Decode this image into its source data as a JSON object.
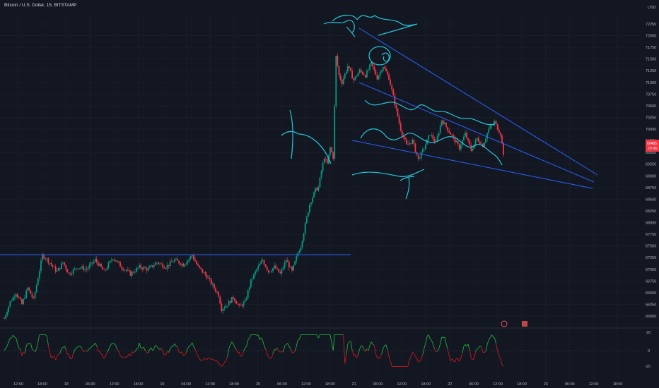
{
  "header": {
    "title": "Bitcoin / U.S. Dollar, 15, BITSTAMP",
    "currency": "USD"
  },
  "price_label": {
    "value": "69485",
    "sub": "07:45",
    "color": "#f23645"
  },
  "indicator_axis": {
    "upper": "20",
    "zero": "0",
    "lower": "-20"
  },
  "colors": {
    "up": "#089981",
    "down": "#f23645",
    "drawing_blue": "#2962ff",
    "drawing_cyan": "#26c6da",
    "osc_up": "#22ab3d",
    "osc_down": "#c5191f"
  },
  "chart_data": {
    "type": "candlestick",
    "title": "Bitcoin / U.S. Dollar, 15, BITSTAMP",
    "y_ticks": [
      "72250",
      "72000",
      "71750",
      "71500",
      "71250",
      "71000",
      "70750",
      "70500",
      "70250",
      "70000",
      "69750",
      "69500",
      "69250",
      "69000",
      "68750",
      "68500",
      "68250",
      "68000",
      "67750",
      "67500",
      "67250",
      "67000",
      "66750",
      "66500",
      "66250",
      "66000"
    ],
    "x_ticks": [
      "12:00",
      "18:00",
      "18",
      "06:00",
      "12:00",
      "18:00",
      "19",
      "06:00",
      "12:00",
      "18:00",
      "20",
      "06:00",
      "12:00",
      "18:00",
      "21",
      "06:00",
      "12:00",
      "18:00",
      "22",
      "06:00",
      "12:00",
      "18:00",
      "23",
      "06:00",
      "12:00",
      "18:00",
      "24"
    ],
    "ylim": [
      65800,
      72400
    ],
    "horizontal_line": 67250,
    "price_path": [
      [
        0,
        65950
      ],
      [
        2,
        66300
      ],
      [
        4,
        66500
      ],
      [
        6,
        66250
      ],
      [
        8,
        66600
      ],
      [
        10,
        66350
      ],
      [
        13,
        67300
      ],
      [
        14,
        67250
      ],
      [
        16,
        67100
      ],
      [
        18,
        66950
      ],
      [
        20,
        67150
      ],
      [
        22,
        66900
      ],
      [
        25,
        67050
      ],
      [
        28,
        67000
      ],
      [
        31,
        67200
      ],
      [
        34,
        66950
      ],
      [
        37,
        67250
      ],
      [
        40,
        67050
      ],
      [
        43,
        66900
      ],
      [
        46,
        67050
      ],
      [
        49,
        67000
      ],
      [
        52,
        67150
      ],
      [
        55,
        67050
      ],
      [
        58,
        67200
      ],
      [
        61,
        67100
      ],
      [
        64,
        67300
      ],
      [
        66,
        67050
      ],
      [
        69,
        66850
      ],
      [
        71,
        66650
      ],
      [
        73,
        66450
      ],
      [
        74,
        66150
      ],
      [
        76,
        66250
      ],
      [
        78,
        66400
      ],
      [
        80,
        66200
      ],
      [
        82,
        66300
      ],
      [
        84,
        66750
      ],
      [
        86,
        67000
      ],
      [
        88,
        67200
      ],
      [
        90,
        66950
      ],
      [
        92,
        67050
      ],
      [
        94,
        66900
      ],
      [
        96,
        67200
      ],
      [
        98,
        66950
      ],
      [
        100,
        67350
      ],
      [
        101,
        67500
      ],
      [
        102,
        67800
      ],
      [
        103,
        68100
      ],
      [
        104,
        68400
      ],
      [
        105,
        68550
      ],
      [
        106,
        68700
      ],
      [
        107,
        68750
      ],
      [
        108,
        69100
      ],
      [
        109,
        69400
      ],
      [
        110,
        69250
      ],
      [
        111,
        69600
      ],
      [
        112,
        69400
      ],
      [
        113,
        71550
      ],
      [
        114,
        71150
      ],
      [
        115,
        71000
      ],
      [
        117,
        71350
      ],
      [
        119,
        71050
      ],
      [
        121,
        71250
      ],
      [
        123,
        71150
      ],
      [
        125,
        71400
      ],
      [
        127,
        71100
      ],
      [
        129,
        71350
      ],
      [
        131,
        71100
      ],
      [
        133,
        70550
      ],
      [
        135,
        70000
      ],
      [
        137,
        69650
      ],
      [
        139,
        69750
      ],
      [
        141,
        69350
      ],
      [
        143,
        69600
      ],
      [
        145,
        69900
      ],
      [
        147,
        69700
      ],
      [
        149,
        70200
      ],
      [
        151,
        70000
      ],
      [
        153,
        69800
      ],
      [
        155,
        69600
      ],
      [
        157,
        69900
      ],
      [
        159,
        69550
      ],
      [
        161,
        69800
      ],
      [
        163,
        69650
      ],
      [
        165,
        70000
      ],
      [
        167,
        70150
      ],
      [
        169,
        69900
      ],
      [
        170,
        69485
      ]
    ],
    "oscillator_range": [
      -30,
      30
    ]
  }
}
